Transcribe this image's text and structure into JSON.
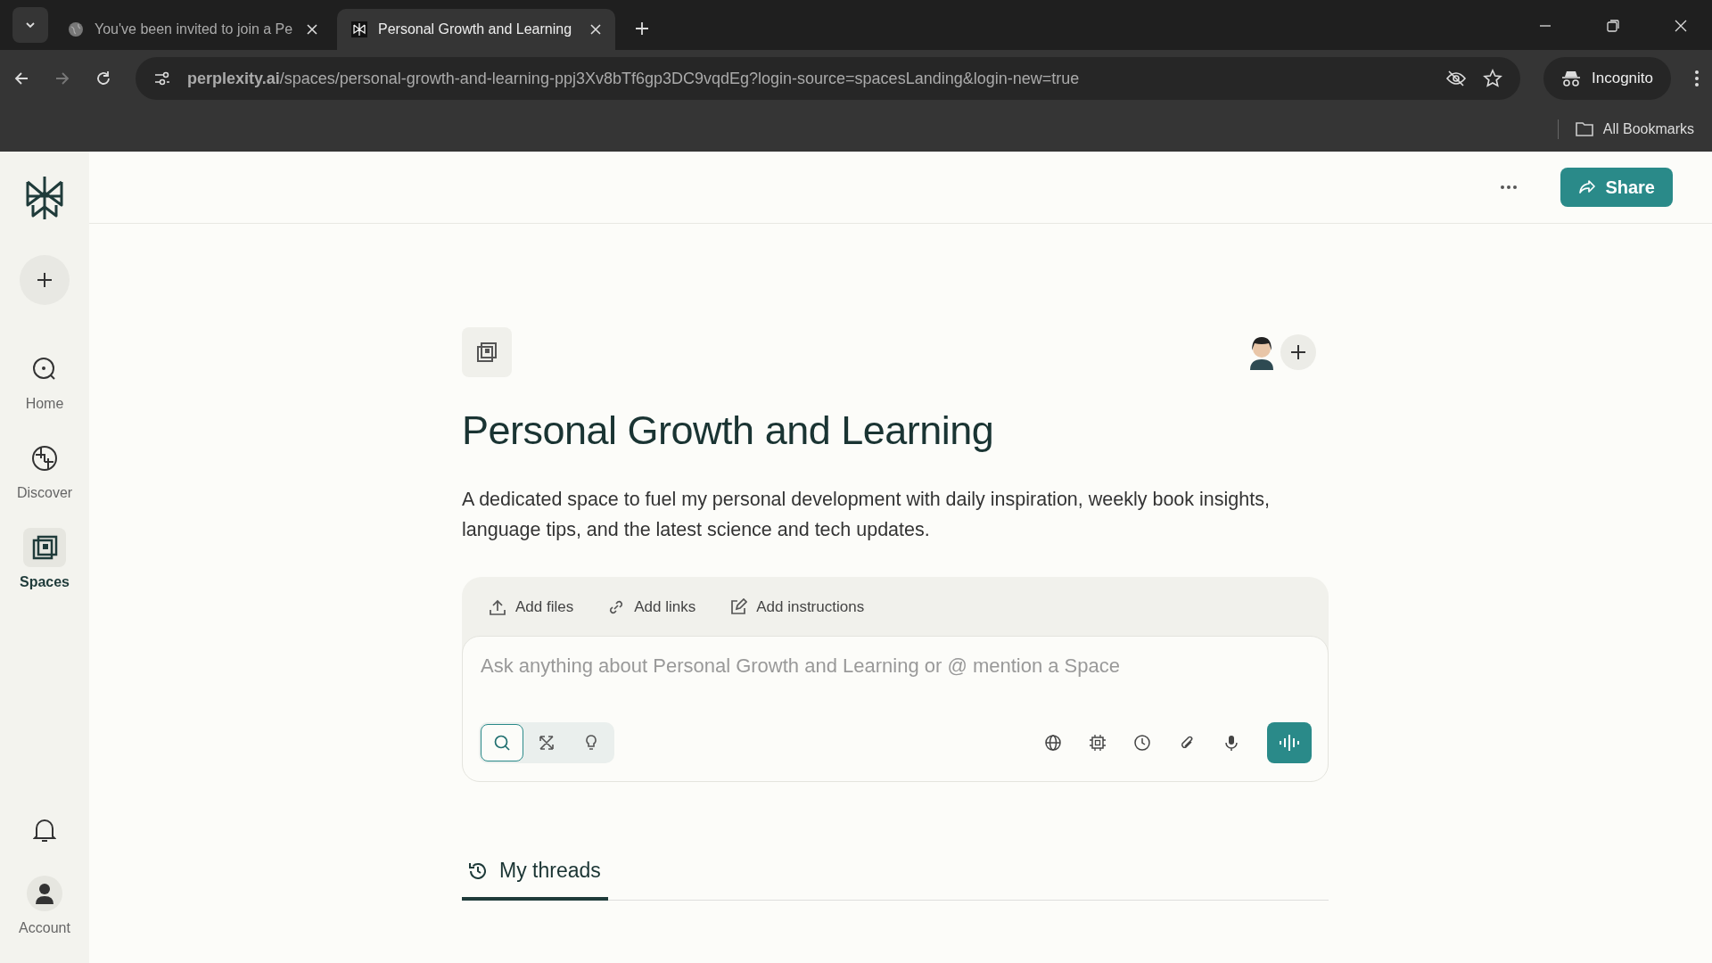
{
  "browser": {
    "tabs": [
      {
        "title": "You've been invited to join a Pe",
        "kind": "globe",
        "selected": false
      },
      {
        "title": "Personal Growth and Learning",
        "kind": "logo",
        "selected": true
      }
    ],
    "url": "**perplexity.ai**/spaces/personal-growth-and-learning-ppj3Xv8bTf6gp3DC9vqdEg?login-source=spacesLanding&login-new=true",
    "profile": "Incognito",
    "bookmarks": "All Bookmarks"
  },
  "sidebar": {
    "items": [
      {
        "label": "Home",
        "kind": "home",
        "selected": false
      },
      {
        "label": "Discover",
        "kind": "discover",
        "selected": false
      },
      {
        "label": "Spaces",
        "kind": "spaces",
        "selected": true
      }
    ],
    "account": "Account"
  },
  "header": {
    "share": "Share"
  },
  "space": {
    "title": "Personal Growth and Learning",
    "description": "A dedicated space to fuel my personal development with daily inspiration, weekly book insights, language tips, and the latest science and tech updates.",
    "actions": [
      {
        "label": "Add files",
        "kind": "upload"
      },
      {
        "label": "Add links",
        "kind": "link"
      },
      {
        "label": "Add instructions",
        "kind": "edit"
      }
    ],
    "placeholder": "Ask anything about Personal Growth and Learning or @ mention a Space",
    "modes": [
      {
        "kind": "search",
        "selected": true
      },
      {
        "kind": "research",
        "selected": false
      },
      {
        "kind": "reason",
        "selected": false
      }
    ],
    "tools": [
      {
        "kind": "globe"
      },
      {
        "kind": "chip"
      },
      {
        "kind": "clock"
      },
      {
        "kind": "clip"
      },
      {
        "kind": "mic"
      }
    ]
  },
  "threads": {
    "label": "My threads",
    "selected": true
  }
}
